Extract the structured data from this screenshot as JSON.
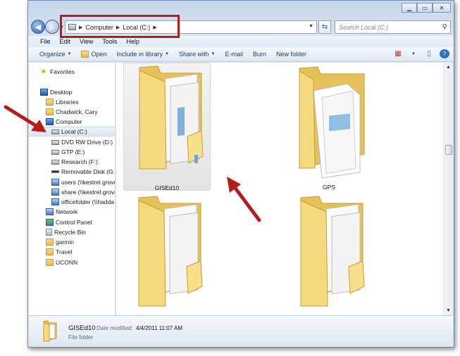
{
  "address": {
    "crumbs": [
      "Computer",
      "Local (C:)"
    ],
    "search_placeholder": "Search Local (C:)"
  },
  "menubar": [
    "File",
    "Edit",
    "View",
    "Tools",
    "Help"
  ],
  "toolbar": {
    "organize": "Organize",
    "open": "Open",
    "include": "Include in library",
    "share": "Share with",
    "email": "E-mail",
    "burn": "Burn",
    "new_folder": "New folder"
  },
  "nav": [
    {
      "label": "Favorites",
      "icon": "star-icon"
    },
    {
      "label": "Desktop",
      "icon": "desktop-icon"
    },
    {
      "label": "Libraries",
      "icon": "libraries-icon"
    },
    {
      "label": "Chadwick, Cary",
      "icon": "user-folder-icon"
    },
    {
      "label": "Computer",
      "icon": "computer-icon"
    },
    {
      "label": "Local (C:)",
      "icon": "drive-icon"
    },
    {
      "label": "DVD RW Drive (D:)",
      "icon": "dvd-drive-icon"
    },
    {
      "label": "GTP (E:)",
      "icon": "drive-icon"
    },
    {
      "label": "Research (F:)",
      "icon": "drive-icon"
    },
    {
      "label": "Removable Disk (G:)",
      "icon": "removable-disk-icon"
    },
    {
      "label": "users (\\\\kestrel.grove",
      "icon": "network-drive-icon"
    },
    {
      "label": "share (\\\\kestrel.grove",
      "icon": "network-drive-icon"
    },
    {
      "label": "officefolder (\\\\hadda",
      "icon": "network-drive-icon"
    },
    {
      "label": "Network",
      "icon": "network-icon"
    },
    {
      "label": "Control Panel",
      "icon": "control-panel-icon"
    },
    {
      "label": "Recycle Bin",
      "icon": "recycle-bin-icon"
    },
    {
      "label": "garmin",
      "icon": "folder-icon"
    },
    {
      "label": "Travel",
      "icon": "folder-icon"
    },
    {
      "label": "UCONN",
      "icon": "folder-icon"
    }
  ],
  "items": [
    {
      "label": "GISEd10"
    },
    {
      "label": "GPS"
    },
    {
      "label": ""
    },
    {
      "label": ""
    }
  ],
  "details": {
    "name": "GISEd10",
    "modified_label": "Date modified:",
    "modified_value": "4/4/2011 11:07 AM",
    "type": "File folder"
  },
  "colors": {
    "annotation_red": "#b71c1c",
    "folder_yellow": "#f2d177"
  }
}
